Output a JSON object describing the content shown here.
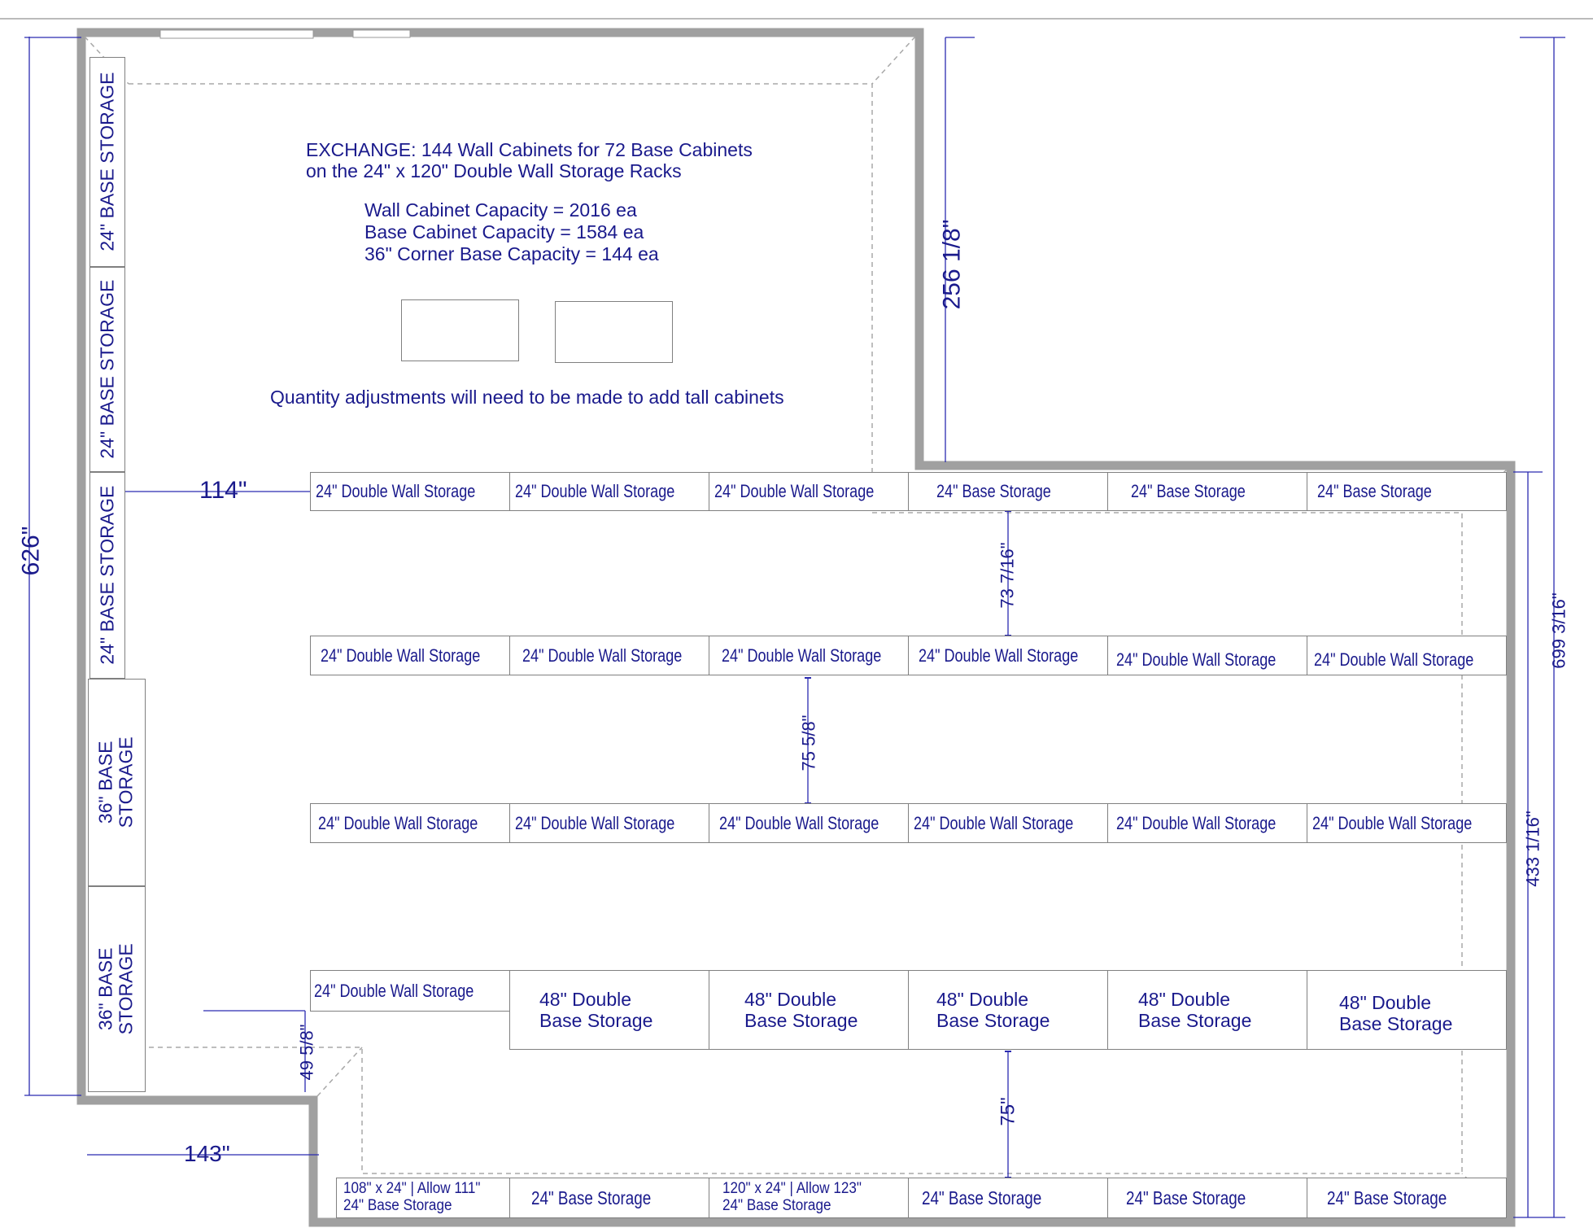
{
  "notes": {
    "exchange_line1": "EXCHANGE: 144 Wall Cabinets for 72 Base Cabinets",
    "exchange_line2": "on the 24\" x 120\" Double Wall Storage Racks",
    "wall_capacity": "Wall Cabinet Capacity = 2016 ea",
    "base_capacity": "Base Cabinet Capacity = 1584 ea",
    "corner_capacity": "36\" Corner Base Capacity = 144 ea",
    "quantity_note": "Quantity adjustments will need to be made to add tall cabinets"
  },
  "left_wall": {
    "base24": [
      "24\" BASE STORAGE",
      "24\" BASE STORAGE",
      "24\" BASE STORAGE"
    ],
    "base36": [
      "36\" BASE STORAGE",
      "36\" BASE STORAGE"
    ]
  },
  "row1": [
    "24\" Double Wall Storage",
    "24\" Double Wall Storage",
    "24\" Double Wall Storage",
    "24\"  Base Storage",
    "24\"  Base Storage",
    "24\"  Base Storage"
  ],
  "row2": [
    "24\" Double Wall Storage",
    "24\" Double Wall Storage",
    "24\" Double Wall Storage",
    "24\" Double Wall Storage",
    "24\" Double Wall Storage",
    "24\" Double Wall Storage"
  ],
  "row3": [
    "24\" Double Wall Storage",
    "24\" Double Wall Storage",
    "24\" Double Wall Storage",
    "24\" Double Wall Storage",
    "24\" Double Wall Storage",
    "24\" Double Wall Storage"
  ],
  "row4": {
    "first": "24\" Double Wall Storage",
    "double_base": [
      [
        "48\" Double",
        "Base Storage"
      ],
      [
        "48\" Double",
        "Base Storage"
      ],
      [
        "48\" Double",
        "Base Storage"
      ],
      [
        "48\" Double",
        "Base Storage"
      ],
      [
        "48\" Double",
        "Base Storage"
      ]
    ]
  },
  "bottom_row": {
    "cell1": [
      "108\" x 24\" | Allow 111\"",
      "24\" Base Storage"
    ],
    "cell2": "24\" Base Storage",
    "cell3": [
      "120\" x 24\" | Allow 123\"",
      "24\" Base Storage"
    ],
    "cell4": "24\" Base Storage",
    "cell5": "24\" Base Storage",
    "cell6": "24\" Base Storage"
  },
  "dimensions": {
    "overall_left": "626\"",
    "upper_right": "256 1/8\"",
    "aisle_left": "114\"",
    "gap1": "73 7/16\"",
    "gap2": "75 5/8\"",
    "gap3": "49 5/8\"",
    "gap4": "75\"",
    "bottom_left": "143\"",
    "right_total": "699 3/16\"",
    "right_lower": "433 1/16\""
  },
  "colors": {
    "wall": "#9e9e9e",
    "text": "#1a1a8c",
    "dim_line": "#2b2bb0",
    "dashed": "#9a9a9a"
  }
}
